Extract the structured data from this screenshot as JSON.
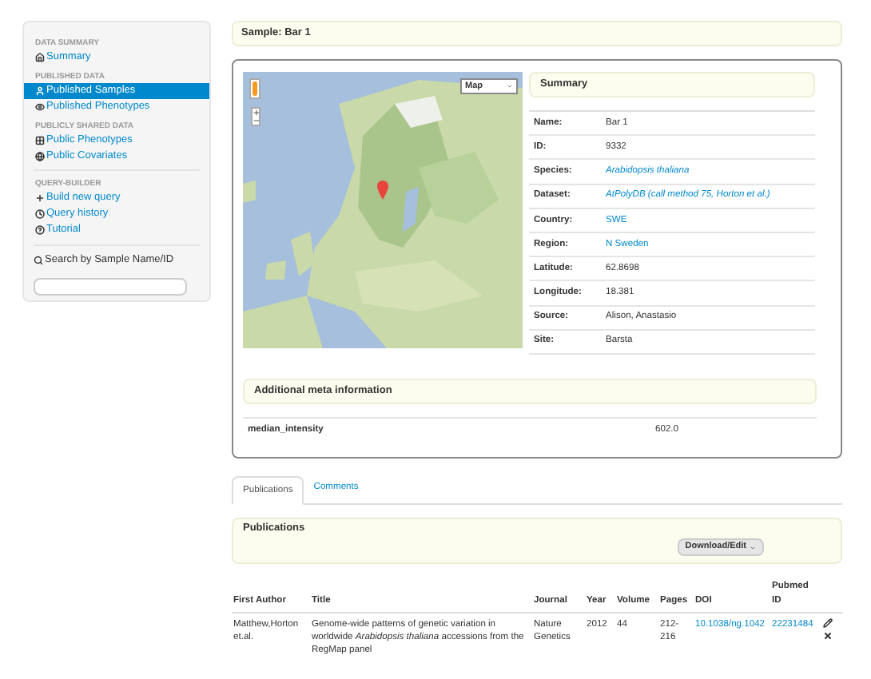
{
  "sidebar": {
    "groups": [
      {
        "heading": "DATA SUMMARY",
        "items": [
          {
            "label": "Summary",
            "selected": false
          }
        ]
      },
      {
        "heading": "PUBLISHED DATA",
        "items": [
          {
            "label": "Published Samples",
            "selected": true
          },
          {
            "label": "Published Phenotypes",
            "selected": false
          }
        ]
      },
      {
        "heading": "PUBLICLY SHARED DATA",
        "items": [
          {
            "label": "Public Phenotypes",
            "selected": false
          },
          {
            "label": "Public Covariates",
            "selected": false
          }
        ]
      },
      {
        "heading": "QUERY-BUILDER",
        "items": [
          {
            "label": "Build new query",
            "selected": false
          },
          {
            "label": "Query history",
            "selected": false
          },
          {
            "label": "Tutorial",
            "selected": false
          }
        ]
      }
    ],
    "search": {
      "label": "Search by Sample Name/ID"
    }
  },
  "sample_title": "Sample: Bar 1",
  "map": {
    "map_type": "Map"
  },
  "summary": {
    "title": "Summary",
    "rows": [
      {
        "label": "Name:",
        "value": "Bar 1",
        "link": false,
        "italic": false
      },
      {
        "label": "ID:",
        "value": "9332",
        "link": false,
        "italic": false
      },
      {
        "label": "Species:",
        "value": "Arabidopsis thaliana",
        "link": true,
        "italic": true
      },
      {
        "label": "Dataset:",
        "value": "AtPolyDB (call method 75, Horton et al.)",
        "link": true,
        "italic": true
      },
      {
        "label": "Country:",
        "value": "SWE",
        "link": true,
        "italic": false
      },
      {
        "label": "Region:",
        "value": "N Sweden",
        "link": true,
        "italic": false
      },
      {
        "label": "Latitude:",
        "value": "62.8698",
        "link": false,
        "italic": false
      },
      {
        "label": "Longitude:",
        "value": "18.381",
        "link": false,
        "italic": false
      },
      {
        "label": "Source:",
        "value": "Alison, Anastasio",
        "link": false,
        "italic": false
      },
      {
        "label": "Site:",
        "value": "Barsta",
        "link": false,
        "italic": false
      }
    ]
  },
  "meta": {
    "title": "Additional meta information",
    "rows": [
      {
        "key": "median_intensity",
        "value": "602.0"
      }
    ]
  },
  "tabs": [
    {
      "label": "Publications",
      "selected": true
    },
    {
      "label": "Comments",
      "selected": false
    }
  ],
  "publications": {
    "title": "Publications",
    "button": "Download/Edit",
    "columns": [
      "First Author",
      "Title",
      "Journal",
      "Year",
      "Volume",
      "Pages",
      "DOI",
      "Pubmed ID"
    ],
    "rows": [
      {
        "first_author": "Matthew,Horton et.al.",
        "title": "Genome-wide patterns of genetic variation in worldwide *Arabidopsis thaliana* accessions from the RegMap panel",
        "journal": "Nature Genetics",
        "year": "2012",
        "volume": "44",
        "pages": "212-216",
        "doi": "10.1038/ng.1042",
        "pubmed_id": "22231484"
      }
    ]
  }
}
